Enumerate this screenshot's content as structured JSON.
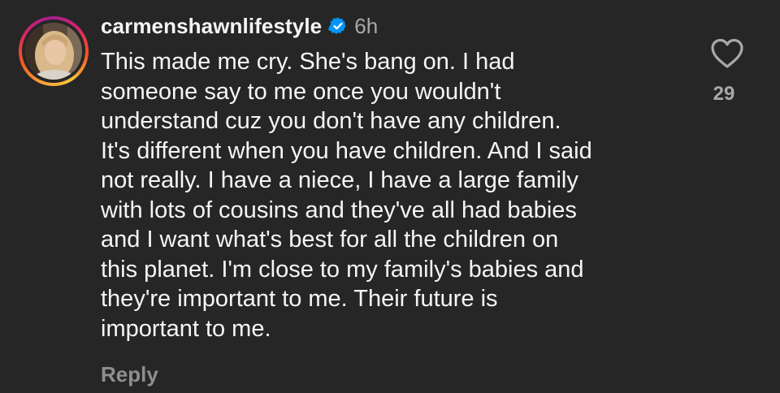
{
  "comment": {
    "username": "carmenshawnlifestyle",
    "time": "6h",
    "verified_icon": "verified-badge-icon",
    "text": "This made me cry. She's bang on. I had\nsomeone say to me once you wouldn't\nunderstand cuz you don't have any children.\nIt's different when you have children. And I said\nnot really. I have a niece, I have a large family\nwith lots of cousins and they've all had babies\nand I want what's best for all the children on\nthis planet. I'm close to my family's babies and\nthey're important to me. Their future is\nimportant to me.",
    "reply_label": "Reply",
    "like_icon": "heart-outline-icon",
    "like_count": "29"
  },
  "colors": {
    "background": "#262626",
    "text_primary": "#f5f5f5",
    "text_secondary": "#a8a8a8",
    "verified_blue": "#0095f6"
  }
}
